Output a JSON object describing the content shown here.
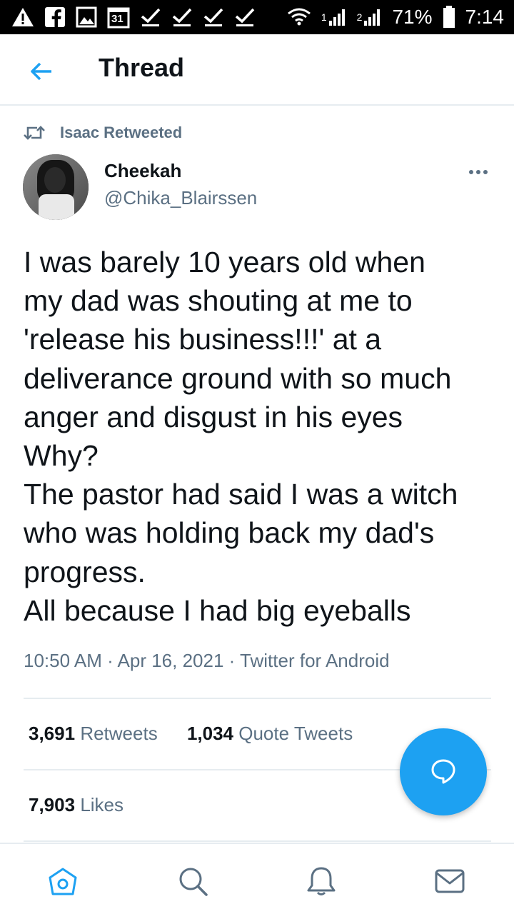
{
  "status_bar": {
    "calendar_day": "31",
    "sim1": "1",
    "sim2": "2",
    "battery": "71%",
    "time": "7:14",
    "icons": [
      "alert-icon",
      "facebook-icon",
      "gallery-icon",
      "calendar-icon",
      "check-icon",
      "check-icon",
      "check-icon",
      "check-icon",
      "wifi-icon",
      "signal-icon",
      "signal-icon",
      "battery-icon"
    ]
  },
  "header": {
    "back_icon": "back-arrow-icon",
    "title": "Thread"
  },
  "tweet": {
    "retweet_context": "Isaac Retweeted",
    "author": {
      "name": "Cheekah",
      "handle": "@Chika_Blairssen"
    },
    "text_lines": [
      "I was barely 10 years old when",
      "my dad was shouting at me to",
      "'release his business!!!' at a",
      "deliverance ground with so much",
      "anger and disgust in his eyes",
      "Why?",
      "The pastor had said I was a witch",
      "who was holding back my dad's",
      "progress.",
      "All because I had big eyeballs"
    ],
    "timestamp": "10:50 AM · Apr 16, 2021 · Twitter for Android",
    "stats": {
      "retweets_count": "3,691",
      "retweets_label": "Retweets",
      "quotes_count": "1,034",
      "quotes_label": "Quote Tweets",
      "likes_count": "7,903",
      "likes_label": "Likes"
    }
  },
  "colors": {
    "accent": "#1da1f2",
    "secondary_text": "#5b7083",
    "divider": "#e6ecf0"
  },
  "bottom_nav": [
    "home-icon",
    "search-icon",
    "notifications-icon",
    "messages-icon"
  ]
}
